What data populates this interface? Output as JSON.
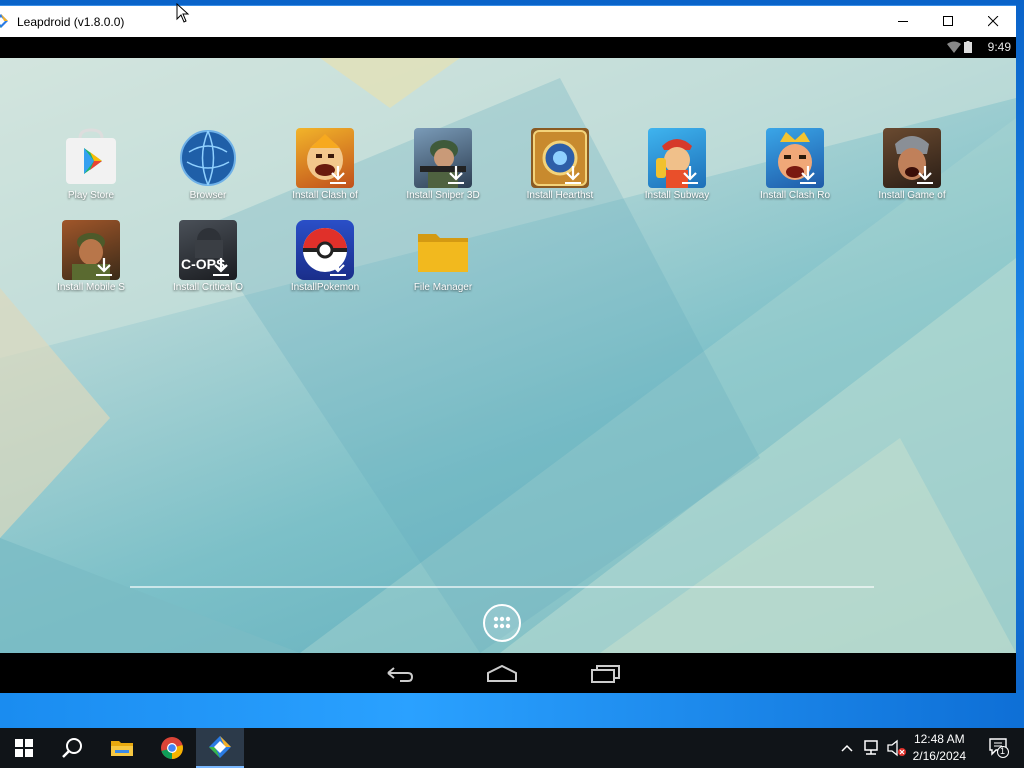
{
  "window": {
    "title": "Leapdroid (v1.8.0.0)"
  },
  "statusbar": {
    "time": "9:49"
  },
  "apps": [
    {
      "label": "Play Store",
      "icon": "play-store-icon"
    },
    {
      "label": "Browser",
      "icon": "browser-icon"
    },
    {
      "label": "Install Clash of",
      "icon": "clash-of-clans-icon"
    },
    {
      "label": "Install Sniper 3D",
      "icon": "sniper-3d-icon"
    },
    {
      "label": "Install Hearthst",
      "icon": "hearthstone-icon"
    },
    {
      "label": "Install Subway",
      "icon": "subway-surfers-icon"
    },
    {
      "label": "Install Clash Ro",
      "icon": "clash-royale-icon"
    },
    {
      "label": "Install Game of",
      "icon": "game-of-war-icon"
    },
    {
      "label": "Install Mobile S",
      "icon": "mobile-strike-icon"
    },
    {
      "label": "Install Critical O",
      "icon": "critical-ops-icon"
    },
    {
      "label": "InstallPokemon",
      "icon": "pokemon-go-icon"
    },
    {
      "label": "File Manager",
      "icon": "folder-icon"
    }
  ],
  "critical_ops_text": "C-OPS",
  "taskbar": {
    "time": "12:48 AM",
    "date": "2/16/2024",
    "notification_count": "1"
  },
  "colors": {
    "taskbar": "#101418",
    "titlebar": "#ffffff",
    "desktop_blue": "#0a63c9"
  }
}
